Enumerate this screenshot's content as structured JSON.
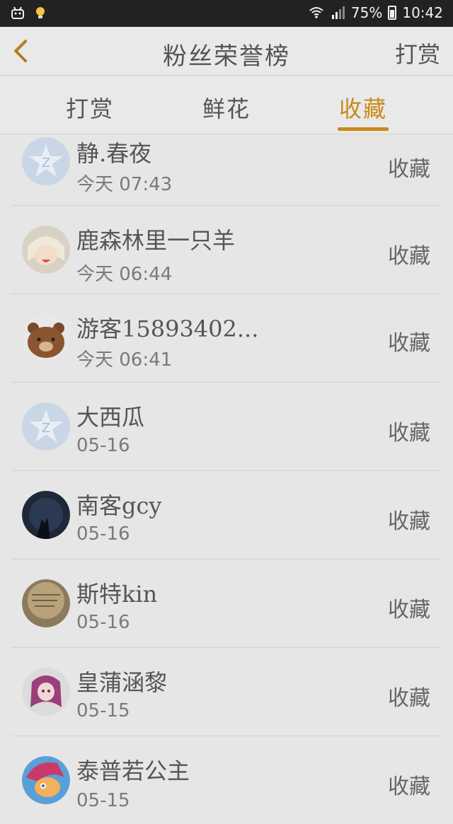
{
  "status_bar": {
    "battery": "75%",
    "time": "10:42",
    "icons": [
      "android-icon",
      "bulb-icon",
      "wifi-icon",
      "signal-icon",
      "battery-icon"
    ]
  },
  "header": {
    "back_icon": "chevron-left-icon",
    "title": "粉丝荣誉榜",
    "action": "打赏"
  },
  "tabs": [
    {
      "label": "打赏",
      "active": false
    },
    {
      "label": "鲜花",
      "active": false
    },
    {
      "label": "收藏",
      "active": true
    }
  ],
  "accent_color": "#c98a17",
  "list": [
    {
      "name": "静.春夜",
      "time": "今天 07:43",
      "action": "收藏",
      "avatar": "qq-star-default"
    },
    {
      "name": "鹿森林里一只羊",
      "time": "今天 06:44",
      "action": "收藏",
      "avatar": "anime-girl"
    },
    {
      "name": "游客15893402...",
      "time": "今天 06:41",
      "action": "收藏",
      "avatar": "brown-bear"
    },
    {
      "name": "大西瓜",
      "time": "05-16",
      "action": "收藏",
      "avatar": "qq-star-default"
    },
    {
      "name": "南客gcy",
      "time": "05-16",
      "action": "收藏",
      "avatar": "night-wolf"
    },
    {
      "name": "斯特kin",
      "time": "05-16",
      "action": "收藏",
      "avatar": "handwriting-sepia"
    },
    {
      "name": "皇蒲涵黎",
      "time": "05-15",
      "action": "收藏",
      "avatar": "anime-pink"
    },
    {
      "name": "泰普若公主",
      "time": "05-15",
      "action": "收藏",
      "avatar": "pony-cartoon"
    }
  ]
}
